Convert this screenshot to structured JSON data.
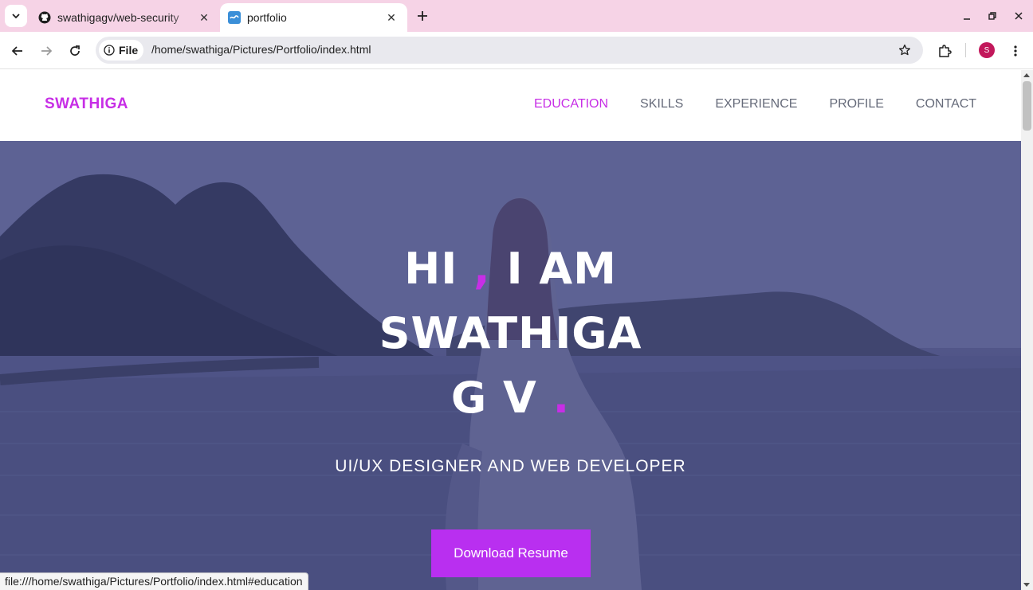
{
  "browser": {
    "tabs": [
      {
        "title": "swathigagv/web-security",
        "active": false,
        "favicon": "github-icon"
      },
      {
        "title": "portfolio",
        "active": true,
        "favicon": "site-favicon"
      }
    ],
    "address": {
      "scheme_label": "File",
      "url": "/home/swathiga/Pictures/Portfolio/index.html"
    },
    "profile_initial": "S",
    "status_url": "file:///home/swathiga/Pictures/Portfolio/index.html#education"
  },
  "site": {
    "logo": "SWATHIGA",
    "nav": [
      {
        "label": "EDUCATION",
        "active": true
      },
      {
        "label": "SKILLS",
        "active": false
      },
      {
        "label": "EXPERIENCE",
        "active": false
      },
      {
        "label": "PROFILE",
        "active": false
      },
      {
        "label": "CONTACT",
        "active": false
      }
    ],
    "hero": {
      "line1_a": "HI ",
      "line1_comma": ",",
      "line1_b": " I AM",
      "line2": "SWATHIGA",
      "line3": "G V ",
      "line3_dot": ".",
      "subtitle": "UI/UX DESIGNER AND WEB DEVELOPER",
      "button": "Download Resume"
    }
  },
  "colors": {
    "accent": "#c72ee6",
    "button": "#b92ff0",
    "tabstrip": "#f6d3e6",
    "nav_text": "#666b7a"
  }
}
